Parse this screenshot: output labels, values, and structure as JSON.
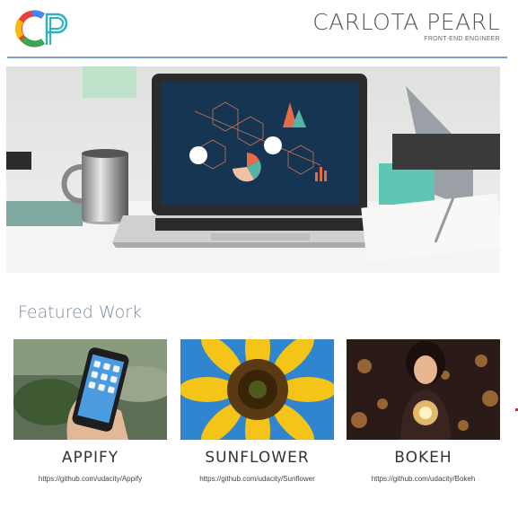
{
  "header": {
    "logo_text": "CP",
    "name": "CARLOTA PEARL",
    "title": "FRONT-END ENGINEER"
  },
  "hero": {
    "icon": "laptop-desk-photo"
  },
  "featured": {
    "heading": "Featured Work",
    "projects": [
      {
        "name": "APPIFY",
        "link": "https://github.com/udacity/Appify",
        "icon": "phone-photo"
      },
      {
        "name": "SUNFLOWER",
        "link": "https://github.com/udacity/Sunflower",
        "icon": "sunflower-photo"
      },
      {
        "name": "BOKEH",
        "link": "https://github.com/udacity/Bokeh",
        "icon": "bokeh-photo"
      }
    ]
  },
  "colors": {
    "rule": "#7d9ec0",
    "heading": "#7a8a9e"
  }
}
